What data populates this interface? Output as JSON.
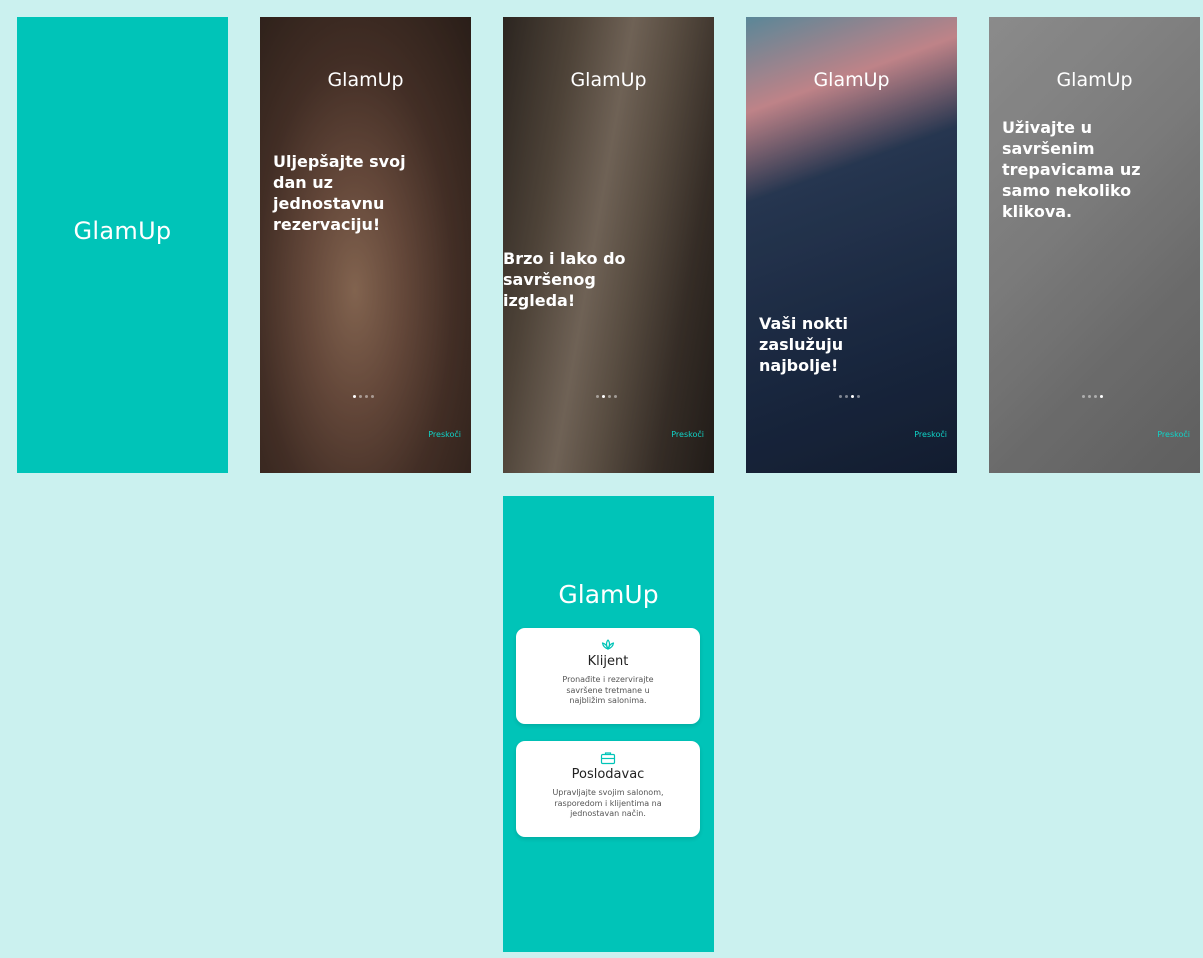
{
  "brand": "GlamUp",
  "skip_label": "Preskoči",
  "splash": {
    "brand": "GlamUp"
  },
  "onboarding": [
    {
      "brand": "GlamUp",
      "headline": "Uljepšajte svoj dan uz jednostavnu rezervaciju!",
      "active_dot": 1
    },
    {
      "brand": "GlamUp",
      "headline": "Brzo i lako do savršenog izgleda!",
      "active_dot": 2
    },
    {
      "brand": "GlamUp",
      "headline": "Vaši nokti zaslužuju najbolje!",
      "active_dot": 3
    },
    {
      "brand": "GlamUp",
      "headline": "Uživajte u savršenim trepavicama uz samo nekoliko klikova.",
      "active_dot": 4
    }
  ],
  "role_select": {
    "brand": "GlamUp",
    "client": {
      "icon": "lotus-icon",
      "title": "Klijent",
      "description": "Pronađite i rezervirajte savršene tretmane u najbližim salonima."
    },
    "employer": {
      "icon": "briefcase-icon",
      "title": "Poslodavac",
      "description": "Upravljajte svojim salonom, rasporedom i klijentima na jednostavan način."
    }
  },
  "colors": {
    "accent": "#00c4b8",
    "background": "#cbf1ef",
    "skip": "#10d4c8"
  }
}
